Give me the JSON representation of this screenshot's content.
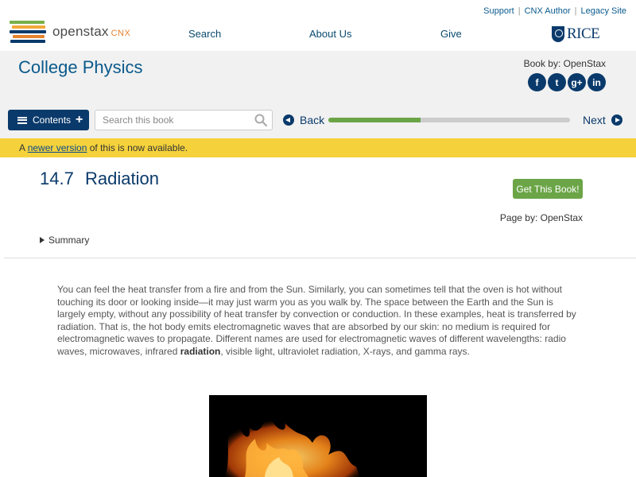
{
  "utility": {
    "support": "Support",
    "cnx_author": "CNX Author",
    "legacy_site": "Legacy Site"
  },
  "header": {
    "logo_text": "openstax",
    "logo_cnx": "CNX",
    "nav": [
      "Search",
      "About Us",
      "Give"
    ],
    "rice": "RICE"
  },
  "book": {
    "title": "College Physics",
    "book_by": "Book by: OpenStax",
    "social": [
      "f",
      "t",
      "g+",
      "in"
    ]
  },
  "toolbar": {
    "contents_label": "Contents",
    "search_placeholder": "Search this book",
    "back_label": "Back",
    "next_label": "Next",
    "progress_fraction": 0.38
  },
  "notice": {
    "prefix": "A ",
    "link": "newer version",
    "suffix": " of this is now available."
  },
  "page": {
    "section_number": "14.7",
    "section_title": "Radiation",
    "get_book": "Get This Book!",
    "page_by": "Page by: OpenStax",
    "summary": "Summary",
    "para_before": "You can feel the heat transfer from a fire and from the Sun. Similarly, you can sometimes tell that the oven is hot without touching its door or looking inside—it may just warm you as you walk by. The space between the Earth and the Sun is largely empty, without any possibility of heat transfer by convection or conduction. In these examples, heat is transferred by radiation. That is, the hot body emits electromagnetic waves that are absorbed by our skin: no medium is required for electromagnetic waves to propagate. Different names are used for electromagnetic waves of different wavelengths: radio waves, microwaves, infrared ",
    "para_bold": "radiation",
    "para_after": ", visible light, ultraviolet radiation, X-rays, and gamma rays."
  },
  "colors": {
    "navy": "#0a3a6b",
    "green": "#6ba547",
    "notice_yellow": "#f5d23c",
    "band_gray": "#f1f1f1"
  }
}
